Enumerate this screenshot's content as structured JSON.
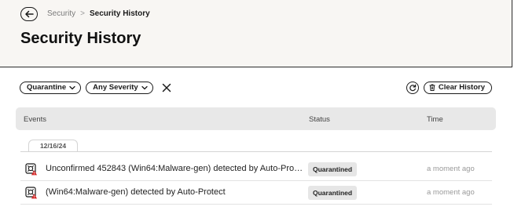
{
  "breadcrumb": {
    "parent": "Security",
    "separator": ">",
    "current": "Security History"
  },
  "page": {
    "title": "Security History"
  },
  "filters": {
    "quarantine_label": "Quarantine",
    "severity_label": "Any Severity"
  },
  "toolbar": {
    "clear_history_label": "Clear History"
  },
  "table": {
    "columns": {
      "events": "Events",
      "status": "Status",
      "time": "Time"
    },
    "date_group": "12/16/24",
    "rows": [
      {
        "event": "Unconfirmed 452843 (Win64:Malware-gen) detected by Auto-Protect",
        "status": "Quarantined",
        "time": "a moment ago"
      },
      {
        "event": "(Win64:Malware-gen) detected by Auto-Protect",
        "status": "Quarantined",
        "time": "a moment ago"
      }
    ]
  },
  "colors": {
    "header_bg": "#f8f6f3",
    "table_head_bg": "#e8e8e8",
    "badge_bg": "#e6e6e6",
    "threat_red": "#d62828"
  },
  "icons": [
    "back-arrow-icon",
    "chevron-down-icon",
    "close-icon",
    "refresh-icon",
    "trash-icon",
    "threat-icon"
  ]
}
